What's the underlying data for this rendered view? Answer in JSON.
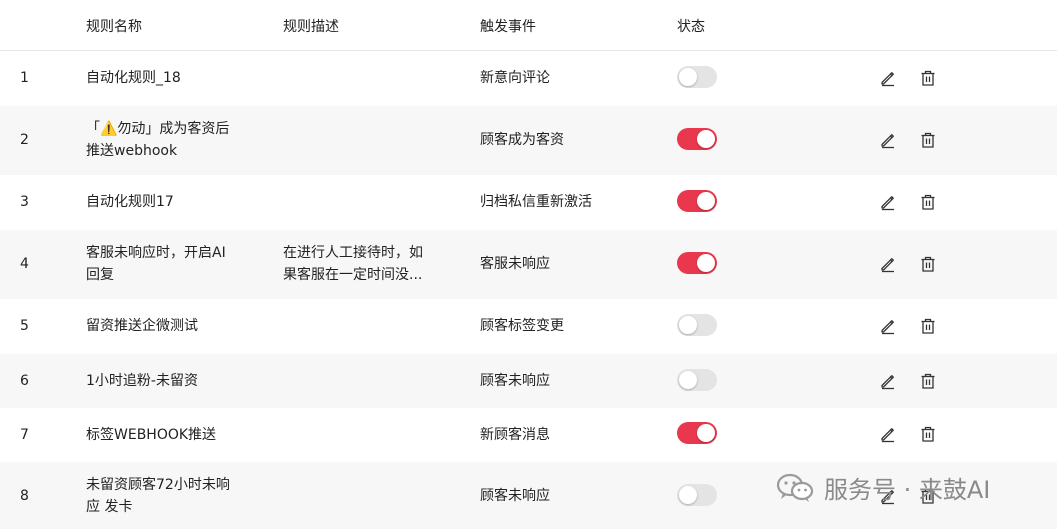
{
  "header": {
    "col_name": "规则名称",
    "col_desc": "规则描述",
    "col_event": "触发事件",
    "col_status": "状态"
  },
  "rows": [
    {
      "index": "1",
      "name_line1": "自动化规则_18",
      "name_line2": "",
      "desc_line1": "",
      "desc_line2": "",
      "event": "新意向评论",
      "status": "off"
    },
    {
      "index": "2",
      "name_line1": "「⚠️勿动」成为客资后",
      "name_line2": "推送webhook",
      "desc_line1": "",
      "desc_line2": "",
      "event": "顾客成为客资",
      "status": "on"
    },
    {
      "index": "3",
      "name_line1": "自动化规则17",
      "name_line2": "",
      "desc_line1": "",
      "desc_line2": "",
      "event": "归档私信重新激活",
      "status": "on"
    },
    {
      "index": "4",
      "name_line1": "客服未响应时，开启AI",
      "name_line2": "回复",
      "desc_line1": "在进行人工接待时，如",
      "desc_line2": "果客服在一定时间没...",
      "event": "客服未响应",
      "status": "on"
    },
    {
      "index": "5",
      "name_line1": "留资推送企微测试",
      "name_line2": "",
      "desc_line1": "",
      "desc_line2": "",
      "event": "顾客标签变更",
      "status": "off"
    },
    {
      "index": "6",
      "name_line1": "1小时追粉-未留资",
      "name_line2": "",
      "desc_line1": "",
      "desc_line2": "",
      "event": "顾客未响应",
      "status": "off"
    },
    {
      "index": "7",
      "name_line1": "标签WEBHOOK推送",
      "name_line2": "",
      "desc_line1": "",
      "desc_line2": "",
      "event": "新顾客消息",
      "status": "on"
    },
    {
      "index": "8",
      "name_line1": "未留资顾客72小时未响",
      "name_line2": "应 发卡",
      "desc_line1": "",
      "desc_line2": "",
      "event": "顾客未响应",
      "status": "off"
    }
  ],
  "watermark": {
    "text": "服务号 · 来鼓AI",
    "icon": "wechat-icon"
  },
  "icons": {
    "edit": "edit-pencil-icon",
    "delete": "trash-icon"
  },
  "colors": {
    "toggle_on": "#e9384d",
    "toggle_off": "#e4e4e4",
    "row_shade": "#f7f7f7"
  }
}
